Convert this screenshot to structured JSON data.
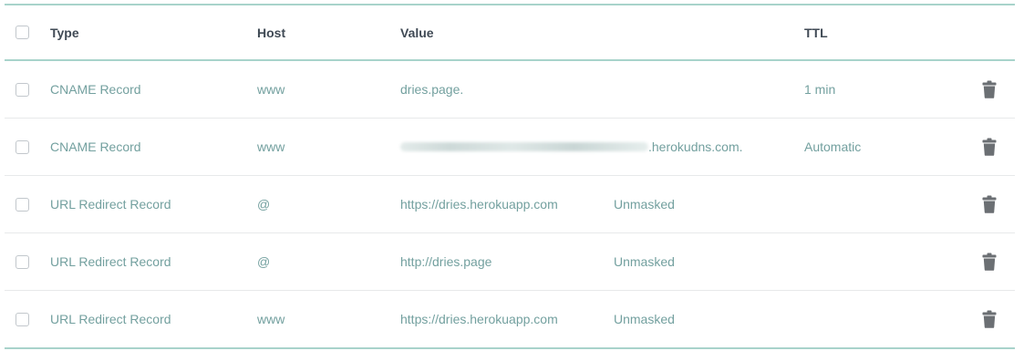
{
  "header": {
    "type": "Type",
    "host": "Host",
    "value": "Value",
    "ttl": "TTL"
  },
  "records": [
    {
      "type": "CNAME Record",
      "host": "www",
      "value": "dries.page.",
      "extra": "",
      "ttl": "1 min",
      "value_redacted": false
    },
    {
      "type": "CNAME Record",
      "host": "www",
      "value": ".herokudns.com.",
      "extra": "",
      "ttl": "Automatic",
      "value_redacted": true
    },
    {
      "type": "URL Redirect Record",
      "host": "@",
      "value": "https://dries.herokuapp.com",
      "extra": "Unmasked",
      "ttl": "",
      "value_redacted": false
    },
    {
      "type": "URL Redirect Record",
      "host": "@",
      "value": "http://dries.page",
      "extra": "Unmasked",
      "ttl": "",
      "value_redacted": false
    },
    {
      "type": "URL Redirect Record",
      "host": "www",
      "value": "https://dries.herokuapp.com",
      "extra": "Unmasked",
      "ttl": "",
      "value_redacted": false
    }
  ],
  "colors": {
    "accent_border": "#a8d3cb",
    "row_text": "#73a09f",
    "header_text": "#404a55",
    "icon": "#6b6f73"
  },
  "icons": {
    "delete": "trash-icon"
  }
}
